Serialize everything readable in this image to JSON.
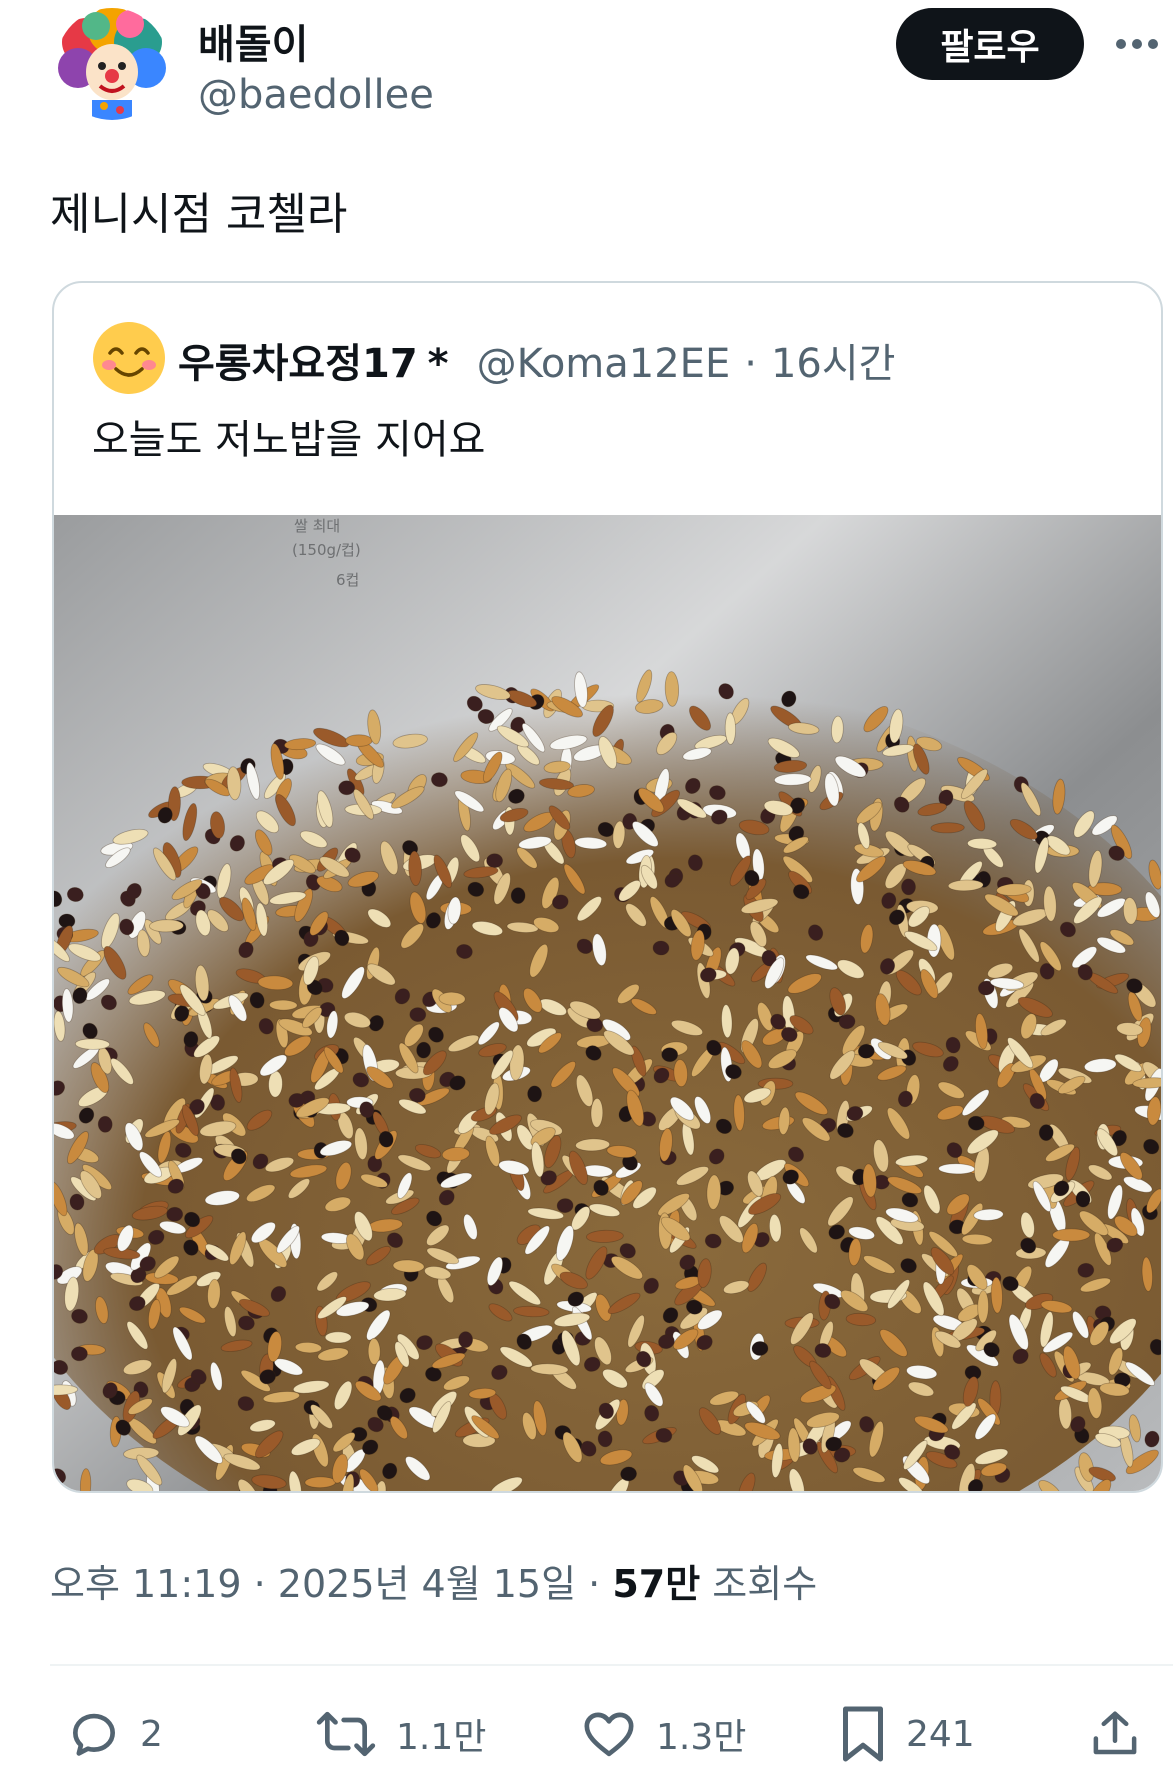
{
  "author": {
    "display_name": "배돌이",
    "handle": "@baedollee",
    "avatar_icon": "clown-avatar"
  },
  "follow_label": "팔로우",
  "more_icon": "more-horizontal-icon",
  "post": {
    "text": "제니시점 코첼라"
  },
  "quoted": {
    "avatar_icon": "smiling-face-avatar",
    "display_name": "우롱차요정17",
    "badge": "*",
    "handle": "@Koma12EE",
    "separator": "·",
    "time": "16시간",
    "text": "오늘도 저노밥을 지어요",
    "image": {
      "pot_markings": [
        "쌀 최대",
        "(150g/컵)",
        "6컵"
      ],
      "grain_colors": [
        "#e0c48c",
        "#d6ac66",
        "#eedfb5",
        "#f6f6f3",
        "#3a1f1f",
        "#1e1414",
        "#9a5a2a",
        "#c98a3e"
      ]
    }
  },
  "meta": {
    "time": "오후 11:19",
    "separator": "·",
    "date": "2025년 4월 15일",
    "views_count": "57만",
    "views_label": "조회수"
  },
  "actions": {
    "reply_count": "2",
    "repost_count": "1.1만",
    "like_count": "1.3만",
    "bookmark_count": "241"
  },
  "colors": {
    "text_primary": "#0f1419",
    "text_secondary": "#536471",
    "border": "#cfd9de",
    "follow_bg": "#0f1419"
  }
}
